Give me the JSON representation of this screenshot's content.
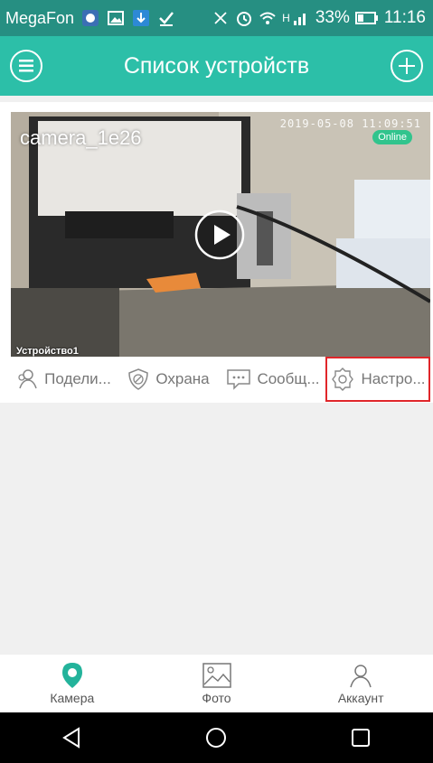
{
  "status_bar": {
    "carrier": "MegaFon",
    "signal_text": "H",
    "battery": "33%",
    "time": "11:16"
  },
  "header": {
    "title": "Список устройств",
    "menu_icon": "menu-icon",
    "add_icon": "plus-icon"
  },
  "device": {
    "name": "camera_1e26",
    "timestamp": "2019-05-08 11:09:51",
    "status": "Online",
    "overlay_label": "Устройство1"
  },
  "actions": [
    {
      "label": "Подели...",
      "icon": "share-user-icon"
    },
    {
      "label": "Охрана",
      "icon": "shield-icon"
    },
    {
      "label": "Сообщ...",
      "icon": "message-icon"
    },
    {
      "label": "Настро...",
      "icon": "settings-icon"
    }
  ],
  "tabs": [
    {
      "label": "Камера",
      "icon": "location-pin-icon",
      "active": true
    },
    {
      "label": "Фото",
      "icon": "photo-icon",
      "active": false
    },
    {
      "label": "Аккаунт",
      "icon": "user-icon",
      "active": false
    }
  ],
  "colors": {
    "header": "#2cbfa8",
    "status_bar": "#268f82",
    "online_badge": "#31c48d",
    "highlight": "#e0262a",
    "active_tab": "#23b39b"
  }
}
